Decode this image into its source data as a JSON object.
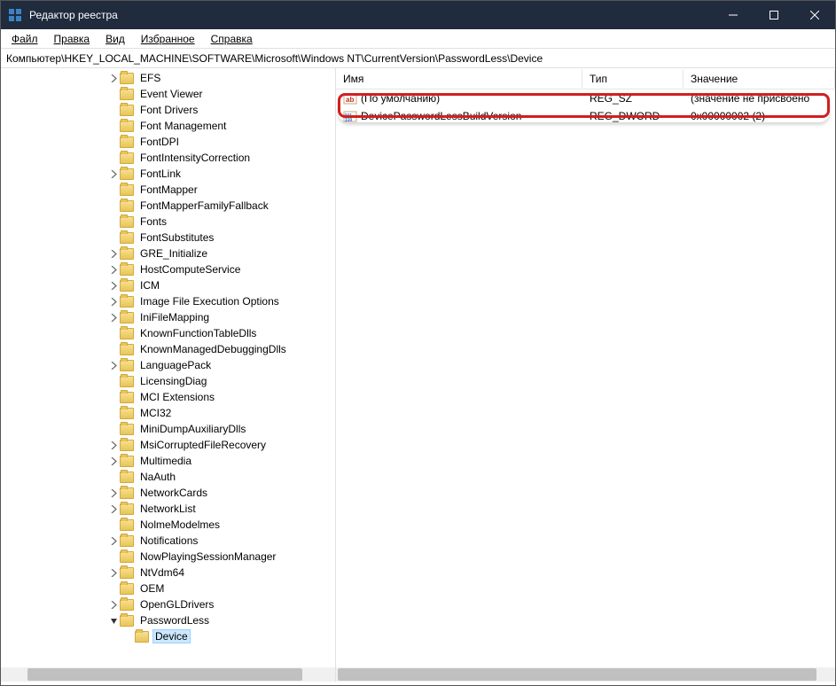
{
  "window": {
    "title": "Редактор реестра"
  },
  "menu": {
    "file": "Файл",
    "edit": "Правка",
    "view": "Вид",
    "favorites": "Избранное",
    "help": "Справка"
  },
  "address": "Компьютер\\HKEY_LOCAL_MACHINE\\SOFTWARE\\Microsoft\\Windows NT\\CurrentVersion\\PasswordLess\\Device",
  "tree": {
    "items": [
      {
        "label": "EFS",
        "chev": "r"
      },
      {
        "label": "Event Viewer",
        "chev": ""
      },
      {
        "label": "Font Drivers",
        "chev": ""
      },
      {
        "label": "Font Management",
        "chev": ""
      },
      {
        "label": "FontDPI",
        "chev": ""
      },
      {
        "label": "FontIntensityCorrection",
        "chev": ""
      },
      {
        "label": "FontLink",
        "chev": "r"
      },
      {
        "label": "FontMapper",
        "chev": ""
      },
      {
        "label": "FontMapperFamilyFallback",
        "chev": ""
      },
      {
        "label": "Fonts",
        "chev": ""
      },
      {
        "label": "FontSubstitutes",
        "chev": ""
      },
      {
        "label": "GRE_Initialize",
        "chev": "r"
      },
      {
        "label": "HostComputeService",
        "chev": "r"
      },
      {
        "label": "ICM",
        "chev": "r"
      },
      {
        "label": "Image File Execution Options",
        "chev": "r"
      },
      {
        "label": "IniFileMapping",
        "chev": "r"
      },
      {
        "label": "KnownFunctionTableDlls",
        "chev": ""
      },
      {
        "label": "KnownManagedDebuggingDlls",
        "chev": ""
      },
      {
        "label": "LanguagePack",
        "chev": "r"
      },
      {
        "label": "LicensingDiag",
        "chev": ""
      },
      {
        "label": "MCI Extensions",
        "chev": ""
      },
      {
        "label": "MCI32",
        "chev": ""
      },
      {
        "label": "MiniDumpAuxiliaryDlls",
        "chev": ""
      },
      {
        "label": "MsiCorruptedFileRecovery",
        "chev": "r"
      },
      {
        "label": "Multimedia",
        "chev": "r"
      },
      {
        "label": "NaAuth",
        "chev": ""
      },
      {
        "label": "NetworkCards",
        "chev": "r"
      },
      {
        "label": "NetworkList",
        "chev": "r"
      },
      {
        "label": "NolmeModelmes",
        "chev": ""
      },
      {
        "label": "Notifications",
        "chev": "r"
      },
      {
        "label": "NowPlayingSessionManager",
        "chev": ""
      },
      {
        "label": "NtVdm64",
        "chev": "r"
      },
      {
        "label": "OEM",
        "chev": ""
      },
      {
        "label": "OpenGLDrivers",
        "chev": "r"
      },
      {
        "label": "PasswordLess",
        "chev": "d",
        "expanded": true
      },
      {
        "label": "Device",
        "chev": "",
        "child": true,
        "selected": true
      }
    ]
  },
  "columns": {
    "name": "Имя",
    "type": "Тип",
    "value": "Значение"
  },
  "values": [
    {
      "icon": "str",
      "name": "(По умолчанию)",
      "type": "REG_SZ",
      "value": "(значение не присвоено"
    },
    {
      "icon": "bin",
      "name": "DevicePasswordLessBuildVersion",
      "type": "REG_DWORD",
      "value": "0x00000002 (2)"
    }
  ]
}
